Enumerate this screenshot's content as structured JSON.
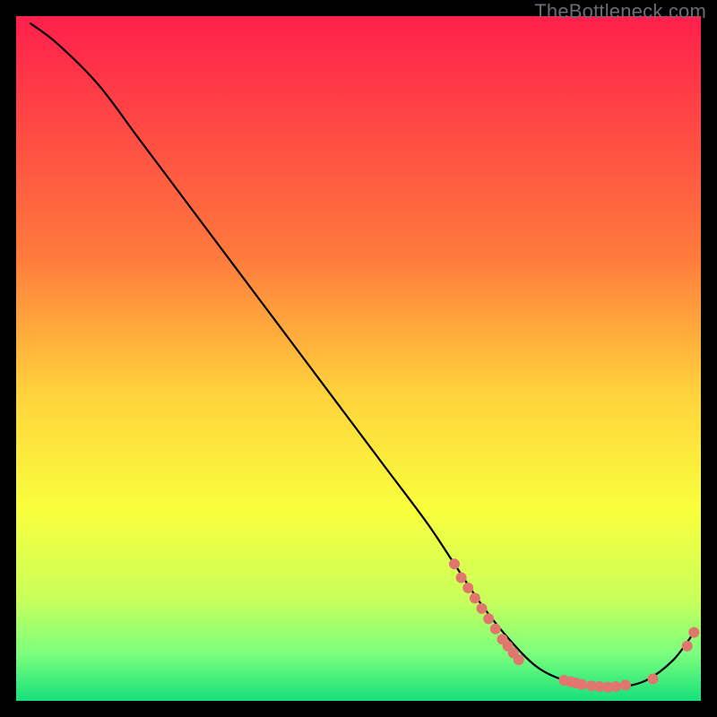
{
  "watermark": "TheBottleneck.com",
  "chart_data": {
    "type": "line",
    "title": "",
    "xlabel": "",
    "ylabel": "",
    "xlim": [
      0,
      100
    ],
    "ylim": [
      0,
      100
    ],
    "grid": false,
    "legend": false,
    "background_gradient": {
      "stops": [
        {
          "offset": 0.0,
          "color": "#ff1f4b"
        },
        {
          "offset": 0.35,
          "color": "#ff7a3c"
        },
        {
          "offset": 0.55,
          "color": "#ffd23c"
        },
        {
          "offset": 0.72,
          "color": "#f9ff3c"
        },
        {
          "offset": 0.85,
          "color": "#c9ff5a"
        },
        {
          "offset": 0.93,
          "color": "#7dff7d"
        },
        {
          "offset": 1.0,
          "color": "#15e07a"
        }
      ]
    },
    "series": [
      {
        "name": "bottleneck-curve",
        "color": "#000000",
        "x": [
          2,
          6,
          12,
          18,
          24,
          30,
          36,
          42,
          48,
          54,
          60,
          64,
          68,
          72,
          76,
          80,
          84,
          88,
          92,
          96,
          99
        ],
        "y": [
          99,
          96,
          90,
          82,
          74,
          66,
          58,
          50,
          42,
          34,
          26,
          20,
          14,
          9,
          5,
          3,
          2,
          2,
          3,
          6,
          10
        ]
      }
    ],
    "markers": [
      {
        "name": "highlight-dots",
        "color": "#e0766e",
        "radius": 6,
        "points": [
          {
            "x": 64,
            "y": 20
          },
          {
            "x": 65,
            "y": 18
          },
          {
            "x": 66,
            "y": 16.5
          },
          {
            "x": 67,
            "y": 15
          },
          {
            "x": 68,
            "y": 13.5
          },
          {
            "x": 69,
            "y": 12
          },
          {
            "x": 70,
            "y": 10.5
          },
          {
            "x": 71,
            "y": 9
          },
          {
            "x": 71.8,
            "y": 8
          },
          {
            "x": 72.6,
            "y": 7
          },
          {
            "x": 73.4,
            "y": 6
          },
          {
            "x": 80,
            "y": 3
          },
          {
            "x": 81,
            "y": 2.8
          },
          {
            "x": 81.8,
            "y": 2.6
          },
          {
            "x": 82.6,
            "y": 2.4
          },
          {
            "x": 84,
            "y": 2.2
          },
          {
            "x": 85.2,
            "y": 2.1
          },
          {
            "x": 86.4,
            "y": 2.0
          },
          {
            "x": 87.6,
            "y": 2.1
          },
          {
            "x": 89,
            "y": 2.3
          },
          {
            "x": 93,
            "y": 3.2
          },
          {
            "x": 98,
            "y": 8
          },
          {
            "x": 99,
            "y": 10
          }
        ]
      }
    ]
  }
}
